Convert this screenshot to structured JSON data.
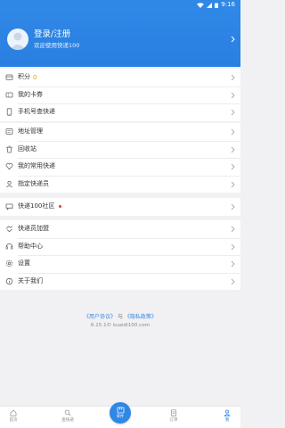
{
  "status_bar": {
    "time": "9:16"
  },
  "header": {
    "login_label": "登录/注册",
    "welcome_text": "欢迎使用快递100"
  },
  "group1": [
    {
      "label": "积分",
      "value": "0",
      "icon": "points-icon"
    },
    {
      "label": "我的卡券",
      "icon": "coupon-icon"
    },
    {
      "label": "手机号查快递",
      "icon": "phone-icon"
    }
  ],
  "group2": [
    {
      "label": "地址管理",
      "icon": "address-icon"
    },
    {
      "label": "回收站",
      "icon": "trash-icon"
    },
    {
      "label": "我的常用快递",
      "icon": "heart-icon"
    },
    {
      "label": "指定快递员",
      "icon": "courier-icon"
    }
  ],
  "group3": [
    {
      "label": "快递100社区",
      "icon": "community-icon"
    }
  ],
  "group4": [
    {
      "label": "快递员加盟",
      "icon": "join-icon"
    },
    {
      "label": "帮助中心",
      "icon": "help-icon"
    },
    {
      "label": "设置",
      "icon": "settings-icon"
    },
    {
      "label": "关于我们",
      "icon": "info-icon"
    }
  ],
  "footer": {
    "user_agreement": "《用户协议》",
    "and_text": "与",
    "privacy_policy": "《隐私政策》",
    "version": "6.15.1© kuaidi100.com"
  },
  "tabbar": {
    "home": "首页",
    "query": "查快递",
    "send": "寄件",
    "orders": "订单",
    "mine": "我"
  },
  "colors": {
    "primary": "#2f87e6",
    "badge_dot": "#e53935",
    "points_value": "#f39c12"
  }
}
